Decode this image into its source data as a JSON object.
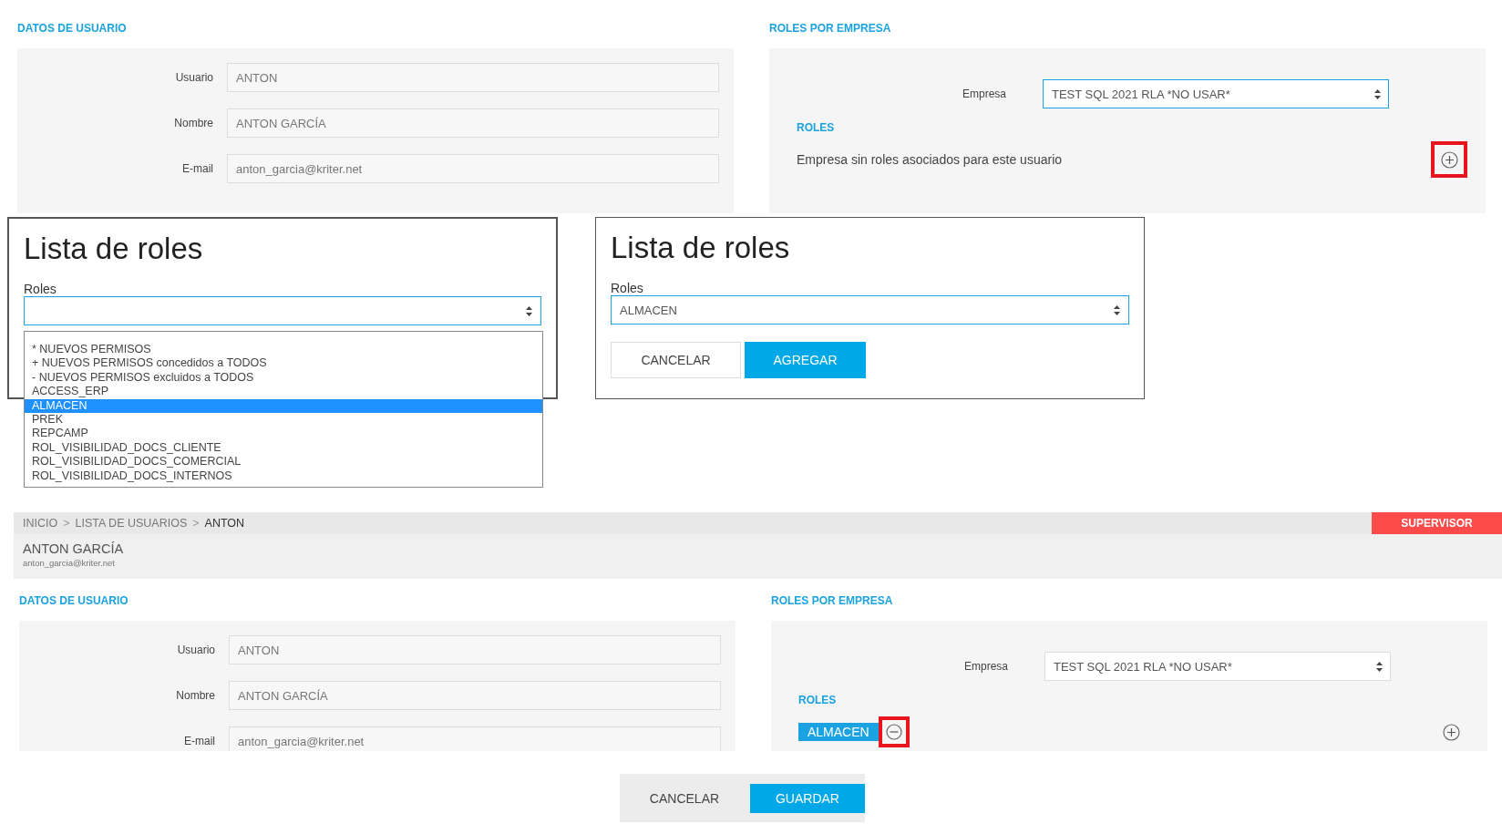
{
  "top_page": {
    "user_section": {
      "title": "DATOS DE USUARIO",
      "fields": [
        {
          "label": "Usuario",
          "value": "ANTON"
        },
        {
          "label": "Nombre",
          "value": "ANTON GARCÍA"
        },
        {
          "label": "E-mail",
          "value": "anton_garcia@kriter.net"
        }
      ]
    },
    "roles_section": {
      "title": "ROLES POR EMPRESA",
      "company_label": "Empresa",
      "company_value": "TEST SQL 2021 RLA *NO USAR*",
      "company_focused": true,
      "roles_title": "ROLES",
      "empty_message": "Empresa sin roles asociados para este usuario",
      "add_highlighted": true
    }
  },
  "dialog_open": {
    "title": "Lista de roles",
    "field_label": "Roles",
    "options": [
      {
        "label": "* NUEVOS PERMISOS",
        "selected": false
      },
      {
        "label": "+ NUEVOS PERMISOS concedidos a TODOS",
        "selected": false
      },
      {
        "label": "- NUEVOS PERMISOS excluidos a TODOS",
        "selected": false
      },
      {
        "label": "ACCESS_ERP",
        "selected": false
      },
      {
        "label": "ALMACEN",
        "selected": true
      },
      {
        "label": "PREK",
        "selected": false
      },
      {
        "label": "REPCAMP",
        "selected": false
      },
      {
        "label": "ROL_VISIBILIDAD_DOCS_CLIENTE",
        "selected": false
      },
      {
        "label": "ROL_VISIBILIDAD_DOCS_COMERCIAL",
        "selected": false
      },
      {
        "label": "ROL_VISIBILIDAD_DOCS_INTERNOS",
        "selected": false
      }
    ]
  },
  "dialog_selected": {
    "title": "Lista de roles",
    "field_label": "Roles",
    "value": "ALMACEN",
    "buttons": [
      {
        "label": "CANCELAR",
        "kind": "secondary"
      },
      {
        "label": "AGREGAR",
        "kind": "primary"
      }
    ]
  },
  "bottom_page": {
    "breadcrumb": [
      {
        "label": "INICIO",
        "current": false
      },
      {
        "label": "LISTA DE USUARIOS",
        "current": false
      },
      {
        "label": "ANTON",
        "current": true
      }
    ],
    "separator": ">",
    "badge": "SUPERVISOR",
    "user_name": "ANTON GARCÍA",
    "user_email": "anton_garcia@kriter.net",
    "user_section": {
      "title": "DATOS DE USUARIO",
      "fields": [
        {
          "label": "Usuario",
          "value": "ANTON"
        },
        {
          "label": "Nombre",
          "value": "ANTON GARCÍA"
        },
        {
          "label": "E-mail",
          "value": "anton_garcia@kriter.net"
        }
      ]
    },
    "roles_section": {
      "title": "ROLES POR EMPRESA",
      "company_label": "Empresa",
      "company_value": "TEST SQL 2021 RLA *NO USAR*",
      "company_focused": false,
      "roles_title": "ROLES",
      "roles": [
        {
          "label": "ALMACEN",
          "remove_highlighted": true
        }
      ],
      "add_highlighted": false
    }
  },
  "footer_buttons": [
    {
      "label": "CANCELAR",
      "kind": "secondary"
    },
    {
      "label": "GUARDAR",
      "kind": "primary"
    }
  ]
}
